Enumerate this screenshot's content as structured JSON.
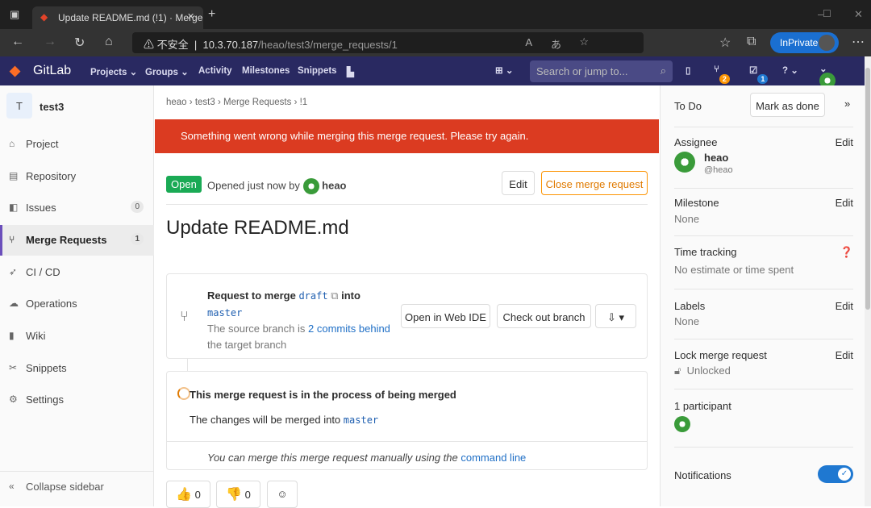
{
  "browser": {
    "tab_title": "Update README.md (!1) · Merge",
    "url_host": "10.3.70.187",
    "url_path": "/heao/test3/merge_requests/1",
    "security": "不安全",
    "inprivate": "InPrivate"
  },
  "nav": {
    "brand": "GitLab",
    "items": [
      "Projects ⌄",
      "Groups ⌄",
      "Activity",
      "Milestones",
      "Snippets"
    ],
    "search_placeholder": "Search or jump to...",
    "mr_count": "2",
    "todo_count": "1"
  },
  "sidebar": {
    "project_initial": "T",
    "project_name": "test3",
    "items": [
      {
        "label": "Project",
        "icon": "home-icon"
      },
      {
        "label": "Repository",
        "icon": "doc-icon"
      },
      {
        "label": "Issues",
        "icon": "issues-icon",
        "count": "0"
      },
      {
        "label": "Merge Requests",
        "icon": "merge-icon",
        "count": "1"
      },
      {
        "label": "CI / CD",
        "icon": "rocket-icon"
      },
      {
        "label": "Operations",
        "icon": "cloud-icon"
      },
      {
        "label": "Wiki",
        "icon": "book-icon"
      },
      {
        "label": "Snippets",
        "icon": "scissors-icon"
      },
      {
        "label": "Settings",
        "icon": "gear-icon"
      }
    ],
    "collapse": "Collapse sidebar"
  },
  "breadcrumb": [
    "heao",
    "test3",
    "Merge Requests",
    "!1"
  ],
  "alert": "Something went wrong while merging this merge request. Please try again.",
  "mr": {
    "status": "Open",
    "opened": "Opened just now by",
    "author": "heao",
    "edit": "Edit",
    "close": "Close merge request",
    "title": "Update README.md",
    "request_to_merge": "Request to merge",
    "source": "draft",
    "into": "into",
    "target": "master",
    "behind_pre": "The source branch is",
    "behind_link": "2 commits behind",
    "behind_post": "the target branch",
    "web_ide": "Open in Web IDE",
    "checkout": "Check out branch",
    "merging": "This merge request is in the process of being merged",
    "merged_into": "The changes will be merged into",
    "merged_target": "master",
    "manual": "You can merge this merge request manually using the",
    "command_line": "command line",
    "thumbs_up": "0",
    "thumbs_down": "0"
  },
  "right": {
    "todo": "To Do",
    "mark_done": "Mark as done",
    "assignee": "Assignee",
    "edit": "Edit",
    "assignee_name": "heao",
    "assignee_user": "@heao",
    "milestone": "Milestone",
    "milestone_val": "None",
    "time": "Time tracking",
    "time_val": "No estimate or time spent",
    "labels": "Labels",
    "labels_val": "None",
    "lock": "Lock merge request",
    "lock_val": "Unlocked",
    "participants": "1 participant",
    "notifications": "Notifications",
    "notifications_on": true
  },
  "colors": {
    "nav": "#292961",
    "alert": "#db3b21",
    "open": "#1aaa55",
    "close_btn": "#fc9403",
    "toggle": "#1f78d1"
  }
}
